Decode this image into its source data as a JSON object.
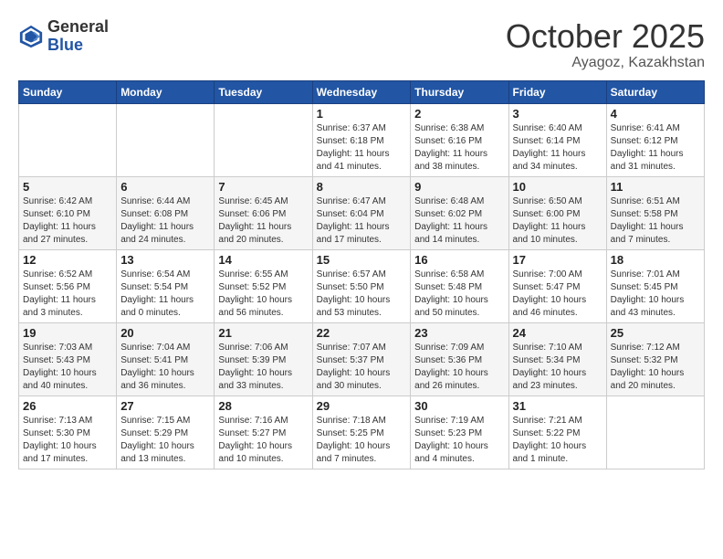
{
  "header": {
    "logo_general": "General",
    "logo_blue": "Blue",
    "month": "October 2025",
    "location": "Ayagoz, Kazakhstan"
  },
  "days_of_week": [
    "Sunday",
    "Monday",
    "Tuesday",
    "Wednesday",
    "Thursday",
    "Friday",
    "Saturday"
  ],
  "weeks": [
    [
      {
        "day": "",
        "info": ""
      },
      {
        "day": "",
        "info": ""
      },
      {
        "day": "",
        "info": ""
      },
      {
        "day": "1",
        "info": "Sunrise: 6:37 AM\nSunset: 6:18 PM\nDaylight: 11 hours\nand 41 minutes."
      },
      {
        "day": "2",
        "info": "Sunrise: 6:38 AM\nSunset: 6:16 PM\nDaylight: 11 hours\nand 38 minutes."
      },
      {
        "day": "3",
        "info": "Sunrise: 6:40 AM\nSunset: 6:14 PM\nDaylight: 11 hours\nand 34 minutes."
      },
      {
        "day": "4",
        "info": "Sunrise: 6:41 AM\nSunset: 6:12 PM\nDaylight: 11 hours\nand 31 minutes."
      }
    ],
    [
      {
        "day": "5",
        "info": "Sunrise: 6:42 AM\nSunset: 6:10 PM\nDaylight: 11 hours\nand 27 minutes."
      },
      {
        "day": "6",
        "info": "Sunrise: 6:44 AM\nSunset: 6:08 PM\nDaylight: 11 hours\nand 24 minutes."
      },
      {
        "day": "7",
        "info": "Sunrise: 6:45 AM\nSunset: 6:06 PM\nDaylight: 11 hours\nand 20 minutes."
      },
      {
        "day": "8",
        "info": "Sunrise: 6:47 AM\nSunset: 6:04 PM\nDaylight: 11 hours\nand 17 minutes."
      },
      {
        "day": "9",
        "info": "Sunrise: 6:48 AM\nSunset: 6:02 PM\nDaylight: 11 hours\nand 14 minutes."
      },
      {
        "day": "10",
        "info": "Sunrise: 6:50 AM\nSunset: 6:00 PM\nDaylight: 11 hours\nand 10 minutes."
      },
      {
        "day": "11",
        "info": "Sunrise: 6:51 AM\nSunset: 5:58 PM\nDaylight: 11 hours\nand 7 minutes."
      }
    ],
    [
      {
        "day": "12",
        "info": "Sunrise: 6:52 AM\nSunset: 5:56 PM\nDaylight: 11 hours\nand 3 minutes."
      },
      {
        "day": "13",
        "info": "Sunrise: 6:54 AM\nSunset: 5:54 PM\nDaylight: 11 hours\nand 0 minutes."
      },
      {
        "day": "14",
        "info": "Sunrise: 6:55 AM\nSunset: 5:52 PM\nDaylight: 10 hours\nand 56 minutes."
      },
      {
        "day": "15",
        "info": "Sunrise: 6:57 AM\nSunset: 5:50 PM\nDaylight: 10 hours\nand 53 minutes."
      },
      {
        "day": "16",
        "info": "Sunrise: 6:58 AM\nSunset: 5:48 PM\nDaylight: 10 hours\nand 50 minutes."
      },
      {
        "day": "17",
        "info": "Sunrise: 7:00 AM\nSunset: 5:47 PM\nDaylight: 10 hours\nand 46 minutes."
      },
      {
        "day": "18",
        "info": "Sunrise: 7:01 AM\nSunset: 5:45 PM\nDaylight: 10 hours\nand 43 minutes."
      }
    ],
    [
      {
        "day": "19",
        "info": "Sunrise: 7:03 AM\nSunset: 5:43 PM\nDaylight: 10 hours\nand 40 minutes."
      },
      {
        "day": "20",
        "info": "Sunrise: 7:04 AM\nSunset: 5:41 PM\nDaylight: 10 hours\nand 36 minutes."
      },
      {
        "day": "21",
        "info": "Sunrise: 7:06 AM\nSunset: 5:39 PM\nDaylight: 10 hours\nand 33 minutes."
      },
      {
        "day": "22",
        "info": "Sunrise: 7:07 AM\nSunset: 5:37 PM\nDaylight: 10 hours\nand 30 minutes."
      },
      {
        "day": "23",
        "info": "Sunrise: 7:09 AM\nSunset: 5:36 PM\nDaylight: 10 hours\nand 26 minutes."
      },
      {
        "day": "24",
        "info": "Sunrise: 7:10 AM\nSunset: 5:34 PM\nDaylight: 10 hours\nand 23 minutes."
      },
      {
        "day": "25",
        "info": "Sunrise: 7:12 AM\nSunset: 5:32 PM\nDaylight: 10 hours\nand 20 minutes."
      }
    ],
    [
      {
        "day": "26",
        "info": "Sunrise: 7:13 AM\nSunset: 5:30 PM\nDaylight: 10 hours\nand 17 minutes."
      },
      {
        "day": "27",
        "info": "Sunrise: 7:15 AM\nSunset: 5:29 PM\nDaylight: 10 hours\nand 13 minutes."
      },
      {
        "day": "28",
        "info": "Sunrise: 7:16 AM\nSunset: 5:27 PM\nDaylight: 10 hours\nand 10 minutes."
      },
      {
        "day": "29",
        "info": "Sunrise: 7:18 AM\nSunset: 5:25 PM\nDaylight: 10 hours\nand 7 minutes."
      },
      {
        "day": "30",
        "info": "Sunrise: 7:19 AM\nSunset: 5:23 PM\nDaylight: 10 hours\nand 4 minutes."
      },
      {
        "day": "31",
        "info": "Sunrise: 7:21 AM\nSunset: 5:22 PM\nDaylight: 10 hours\nand 1 minute."
      },
      {
        "day": "",
        "info": ""
      }
    ]
  ]
}
